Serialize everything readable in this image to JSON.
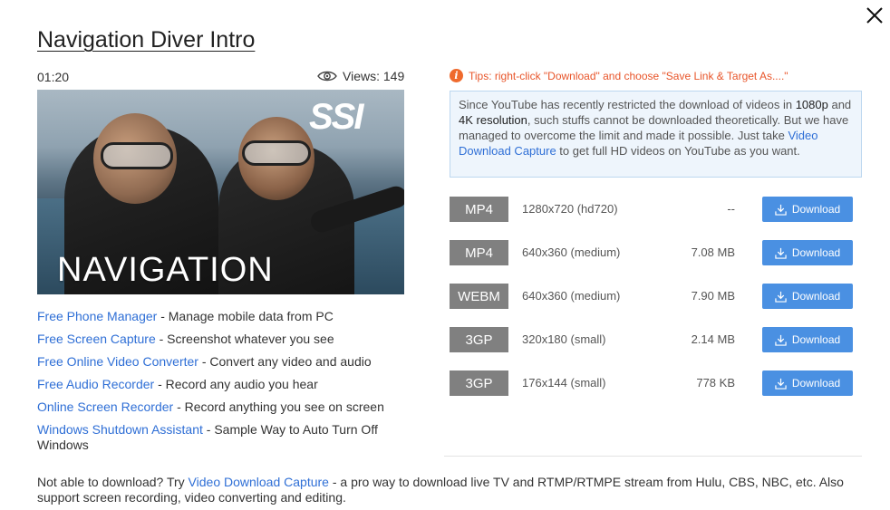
{
  "title": "Navigation Diver Intro",
  "meta": {
    "duration": "01:20",
    "views": "Views: 149"
  },
  "thumbnail": {
    "caption": "NAVIGATION",
    "logo": "SSI"
  },
  "links": [
    {
      "link": "Free Phone Manager",
      "desc": " - Manage mobile data from PC"
    },
    {
      "link": "Free Screen Capture",
      "desc": " - Screenshot whatever you see"
    },
    {
      "link": "Free Online Video Converter",
      "desc": " - Convert any video and audio"
    },
    {
      "link": "Free Audio Recorder",
      "desc": " - Record any audio you hear"
    },
    {
      "link": "Online Screen Recorder",
      "desc": " - Record anything you see on screen"
    },
    {
      "link": "Windows Shutdown Assistant",
      "desc": " - Sample Way to Auto Turn Off Windows"
    }
  ],
  "tip": "Tips: right-click \"Download\" and choose \"Save Link & Target As....\"",
  "info": {
    "t1": "Since YouTube has recently restricted the download of videos in ",
    "b1": "1080p",
    "t2": " and ",
    "b2": "4K resolution",
    "t3": ", such stuffs cannot be downloaded theoretically. But we have managed to overcome the limit and made it possible. Just take ",
    "link": "Video Download Capture",
    "t4": " to get full HD videos on YouTube as you want."
  },
  "downloads": [
    {
      "format": "MP4",
      "resolution": "1280x720 (hd720)",
      "size": "--",
      "button": "Download"
    },
    {
      "format": "MP4",
      "resolution": "640x360 (medium)",
      "size": "7.08 MB",
      "button": "Download"
    },
    {
      "format": "WEBM",
      "resolution": "640x360 (medium)",
      "size": "7.90 MB",
      "button": "Download"
    },
    {
      "format": "3GP",
      "resolution": "320x180 (small)",
      "size": "2.14 MB",
      "button": "Download"
    },
    {
      "format": "3GP",
      "resolution": "176x144 (small)",
      "size": "778 KB",
      "button": "Download"
    }
  ],
  "footer": {
    "t1": "Not able to download? Try ",
    "link": "Video Download Capture",
    "t2": " - a pro way to download live TV and RTMP/RTMPE stream from Hulu, CBS, NBC, etc. Also support screen recording, video converting and editing."
  },
  "colors": {
    "link": "#2f6fd6",
    "button": "#4a90e2",
    "format_badge": "#808080",
    "tip": "#e8552a",
    "info_bg": "#eef5fc"
  },
  "icons": {
    "close": "close-icon",
    "views": "eye-icon",
    "tip": "info-icon",
    "download": "download-icon"
  }
}
